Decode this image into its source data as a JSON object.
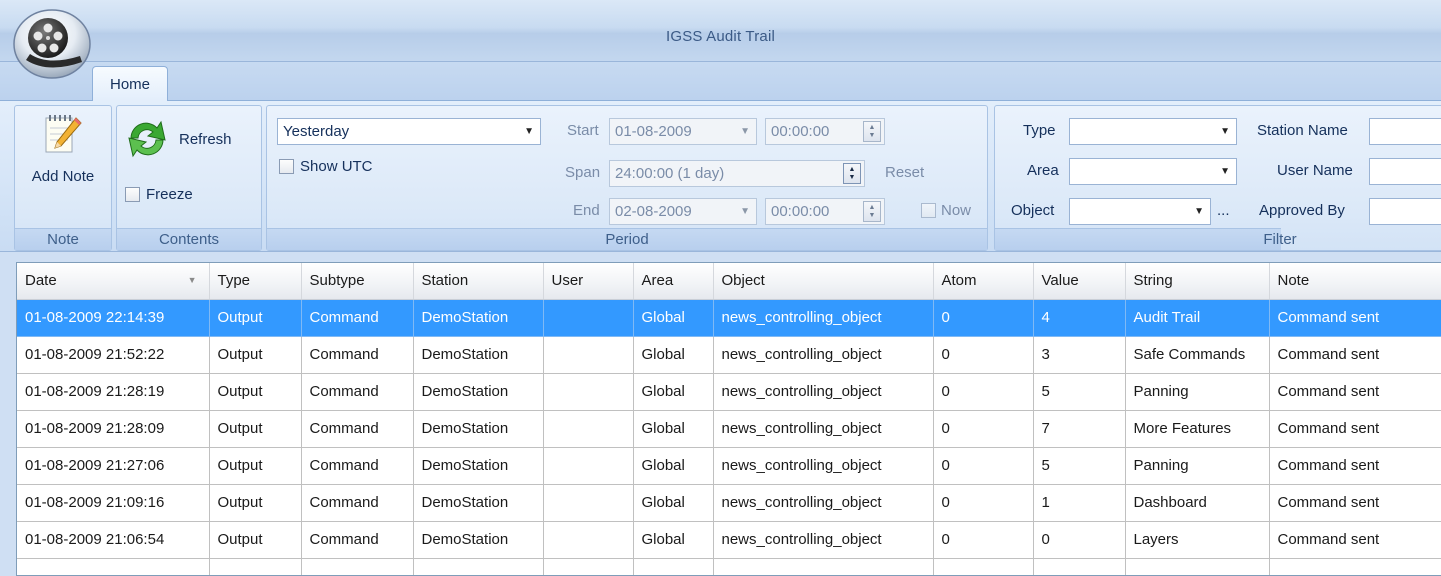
{
  "window": {
    "title": "IGSS Audit Trail"
  },
  "tabs": [
    {
      "label": "Home"
    }
  ],
  "ribbon": {
    "note_group": {
      "label": "Note",
      "add_note": "Add Note"
    },
    "contents_group": {
      "label": "Contents",
      "refresh": "Refresh",
      "freeze": "Freeze"
    },
    "period_group": {
      "label": "Period",
      "preset": "Yesterday",
      "show_utc": "Show UTC",
      "start_label": "Start",
      "start_date": "01-08-2009",
      "start_time": "00:00:00",
      "span_label": "Span",
      "span_value": "24:00:00 (1 day)",
      "reset": "Reset",
      "end_label": "End",
      "end_date": "02-08-2009",
      "end_time": "00:00:00",
      "now": "Now"
    },
    "filter_group": {
      "label": "Filter",
      "type_label": "Type",
      "area_label": "Area",
      "object_label": "Object",
      "object_browse": "...",
      "station_name_label": "Station Name",
      "user_name_label": "User Name",
      "approved_by_label": "Approved By"
    }
  },
  "table": {
    "columns": [
      "Date",
      "Type",
      "Subtype",
      "Station",
      "User",
      "Area",
      "Object",
      "Atom",
      "Value",
      "String",
      "Note"
    ],
    "rows": [
      [
        "01-08-2009 22:14:39",
        "Output",
        "Command",
        "DemoStation",
        "",
        "Global",
        "news_controlling_object",
        "0",
        "4",
        "Audit Trail",
        "Command sent"
      ],
      [
        "01-08-2009 21:52:22",
        "Output",
        "Command",
        "DemoStation",
        "",
        "Global",
        "news_controlling_object",
        "0",
        "3",
        "Safe Commands",
        "Command sent"
      ],
      [
        "01-08-2009 21:28:19",
        "Output",
        "Command",
        "DemoStation",
        "",
        "Global",
        "news_controlling_object",
        "0",
        "5",
        "Panning",
        "Command sent"
      ],
      [
        "01-08-2009 21:28:09",
        "Output",
        "Command",
        "DemoStation",
        "",
        "Global",
        "news_controlling_object",
        "0",
        "7",
        "More Features",
        "Command sent"
      ],
      [
        "01-08-2009 21:27:06",
        "Output",
        "Command",
        "DemoStation",
        "",
        "Global",
        "news_controlling_object",
        "0",
        "5",
        "Panning",
        "Command sent"
      ],
      [
        "01-08-2009 21:09:16",
        "Output",
        "Command",
        "DemoStation",
        "",
        "Global",
        "news_controlling_object",
        "0",
        "1",
        "Dashboard",
        "Command sent"
      ],
      [
        "01-08-2009 21:06:54",
        "Output",
        "Command",
        "DemoStation",
        "",
        "Global",
        "news_controlling_object",
        "0",
        "0",
        "Layers",
        "Command sent"
      ]
    ],
    "selected_row": 0
  },
  "colors": {
    "selection": "#3399ff",
    "ribbon_text": "#15305b",
    "group_label": "#3e5f8a"
  },
  "icons": [
    "application-orb-film-reel-icon",
    "notepad-pencil-icon",
    "refresh-arrows-icon",
    "sort-descending-icon"
  ]
}
